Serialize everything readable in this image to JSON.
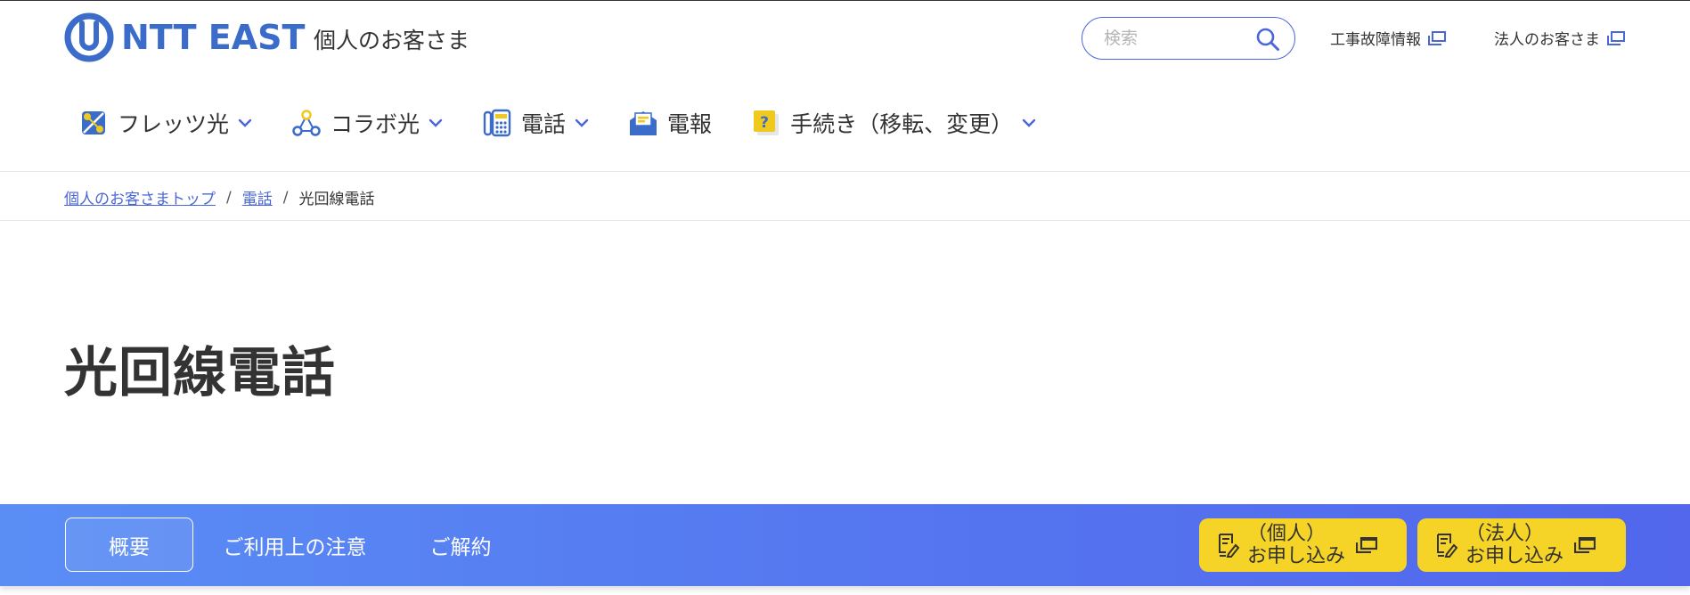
{
  "header": {
    "brand": "NTT EAST",
    "brand_sub": "個人のお客さま",
    "search_placeholder": "検索",
    "util_links": [
      {
        "label": "工事故障情報"
      },
      {
        "label": "法人のお客さま"
      }
    ]
  },
  "nav": {
    "items": [
      {
        "label": "フレッツ光",
        "icon": "fiber-icon",
        "has_dropdown": true
      },
      {
        "label": "コラボ光",
        "icon": "collab-icon",
        "has_dropdown": true
      },
      {
        "label": "電話",
        "icon": "phone-icon",
        "has_dropdown": true
      },
      {
        "label": "電報",
        "icon": "telegram-icon",
        "has_dropdown": false
      },
      {
        "label": "手続き（移転、変更）",
        "icon": "procedure-icon",
        "has_dropdown": true
      }
    ]
  },
  "breadcrumb": {
    "items": [
      {
        "label": "個人のお客さまトップ",
        "link": true
      },
      {
        "label": "電話",
        "link": true
      },
      {
        "label": "光回線電話",
        "link": false
      }
    ],
    "separator": "/"
  },
  "page": {
    "title": "光回線電話"
  },
  "subnav": {
    "tabs": [
      {
        "label": "概要",
        "active": true
      },
      {
        "label": "ご利用上の注意",
        "active": false
      },
      {
        "label": "ご解約",
        "active": false
      }
    ],
    "apply_buttons": [
      {
        "line1": "（個人）",
        "line2": "お申し込み"
      },
      {
        "line1": "（法人）",
        "line2": "お申し込み"
      }
    ]
  },
  "colors": {
    "brand_blue": "#3b6cc9",
    "link_blue": "#4a66d8",
    "bar_start": "#5a8ef5",
    "bar_end": "#5267ec",
    "apply_yellow": "#f5d327",
    "icon_yellow": "#f0c91f"
  }
}
